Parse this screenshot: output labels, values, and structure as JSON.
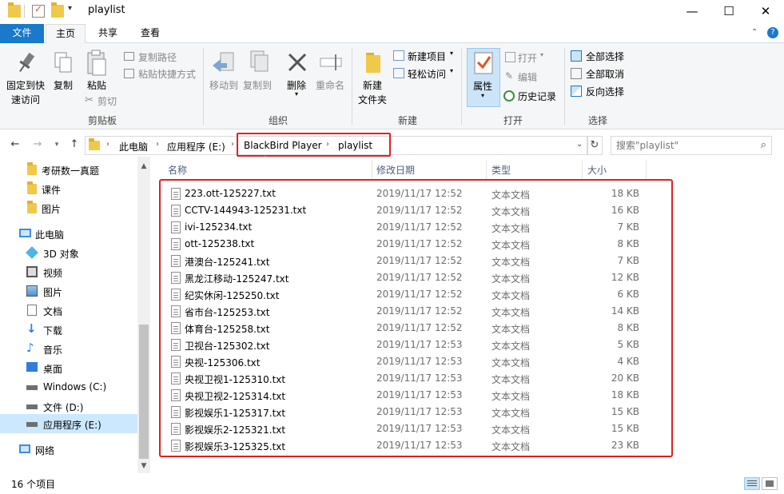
{
  "window": {
    "title": "playlist",
    "minimize": "—",
    "maximize": "☐",
    "close": "✕"
  },
  "tabs": {
    "file": "文件",
    "home": "主页",
    "share": "共享",
    "view": "查看"
  },
  "ribbon": {
    "clipboard": {
      "group": "剪贴板",
      "pin": "固定到快\n速访问",
      "pin_line1": "固定到快",
      "pin_line2": "速访问",
      "copy": "复制",
      "paste": "粘贴",
      "copy_path": "复制路径",
      "paste_shortcut": "粘贴快捷方式",
      "cut": "剪切"
    },
    "organize": {
      "group": "组织",
      "move_to": "移动到",
      "copy_to": "复制到",
      "delete": "删除",
      "rename": "重命名"
    },
    "new": {
      "group": "新建",
      "new_folder_line1": "新建",
      "new_folder_line2": "文件夹",
      "new_item": "新建项目",
      "easy_access": "轻松访问"
    },
    "open": {
      "group": "打开",
      "properties": "属性",
      "open": "打开",
      "edit": "编辑",
      "history": "历史记录"
    },
    "select": {
      "group": "选择",
      "select_all": "全部选择",
      "select_none": "全部取消",
      "invert": "反向选择"
    }
  },
  "address": {
    "crumbs": [
      "此电脑",
      "应用程序 (E:)",
      "BlackBird Player",
      "playlist"
    ],
    "search_placeholder": "搜索\"playlist\""
  },
  "nav": {
    "items": [
      {
        "label": "考研数一真题",
        "icon": "folder-icon"
      },
      {
        "label": "课件",
        "icon": "folder-icon"
      },
      {
        "label": "图片",
        "icon": "folder-icon"
      },
      {
        "label": "此电脑",
        "icon": "computer-icon"
      },
      {
        "label": "3D 对象",
        "icon": "cube-icon"
      },
      {
        "label": "视频",
        "icon": "video-icon"
      },
      {
        "label": "图片",
        "icon": "pictures-icon"
      },
      {
        "label": "文档",
        "icon": "documents-icon"
      },
      {
        "label": "下载",
        "icon": "download-icon"
      },
      {
        "label": "音乐",
        "icon": "music-icon"
      },
      {
        "label": "桌面",
        "icon": "desktop-icon"
      },
      {
        "label": "Windows (C:)",
        "icon": "drive-icon"
      },
      {
        "label": "文件 (D:)",
        "icon": "drive-icon"
      },
      {
        "label": "应用程序 (E:)",
        "icon": "drive-icon"
      },
      {
        "label": "网络",
        "icon": "network-icon"
      }
    ]
  },
  "columns": {
    "name": "名称",
    "date": "修改日期",
    "type": "类型",
    "size": "大小"
  },
  "files": [
    {
      "name": "223.ott-125227.txt",
      "date": "2019/11/17 12:52",
      "type": "文本文档",
      "size": "18 KB"
    },
    {
      "name": "CCTV-144943-125231.txt",
      "date": "2019/11/17 12:52",
      "type": "文本文档",
      "size": "16 KB"
    },
    {
      "name": "ivi-125234.txt",
      "date": "2019/11/17 12:52",
      "type": "文本文档",
      "size": "7 KB"
    },
    {
      "name": "ott-125238.txt",
      "date": "2019/11/17 12:52",
      "type": "文本文档",
      "size": "8 KB"
    },
    {
      "name": "港澳台-125241.txt",
      "date": "2019/11/17 12:52",
      "type": "文本文档",
      "size": "7 KB"
    },
    {
      "name": "黑龙江移动-125247.txt",
      "date": "2019/11/17 12:52",
      "type": "文本文档",
      "size": "12 KB"
    },
    {
      "name": "纪实休闲-125250.txt",
      "date": "2019/11/17 12:52",
      "type": "文本文档",
      "size": "6 KB"
    },
    {
      "name": "省市台-125253.txt",
      "date": "2019/11/17 12:52",
      "type": "文本文档",
      "size": "14 KB"
    },
    {
      "name": "体育台-125258.txt",
      "date": "2019/11/17 12:52",
      "type": "文本文档",
      "size": "8 KB"
    },
    {
      "name": "卫视台-125302.txt",
      "date": "2019/11/17 12:53",
      "type": "文本文档",
      "size": "5 KB"
    },
    {
      "name": "央视-125306.txt",
      "date": "2019/11/17 12:53",
      "type": "文本文档",
      "size": "4 KB"
    },
    {
      "name": "央视卫视1-125310.txt",
      "date": "2019/11/17 12:53",
      "type": "文本文档",
      "size": "20 KB"
    },
    {
      "name": "央视卫视2-125314.txt",
      "date": "2019/11/17 12:53",
      "type": "文本文档",
      "size": "18 KB"
    },
    {
      "name": "影视娱乐1-125317.txt",
      "date": "2019/11/17 12:53",
      "type": "文本文档",
      "size": "15 KB"
    },
    {
      "name": "影视娱乐2-125321.txt",
      "date": "2019/11/17 12:53",
      "type": "文本文档",
      "size": "15 KB"
    },
    {
      "name": "影视娱乐3-125325.txt",
      "date": "2019/11/17 12:53",
      "type": "文本文档",
      "size": "23 KB"
    }
  ],
  "status": {
    "count": "16 个项目"
  },
  "colors": {
    "accent": "#1979ca",
    "highlight": "#e02020",
    "selected": "#cce8ff"
  }
}
